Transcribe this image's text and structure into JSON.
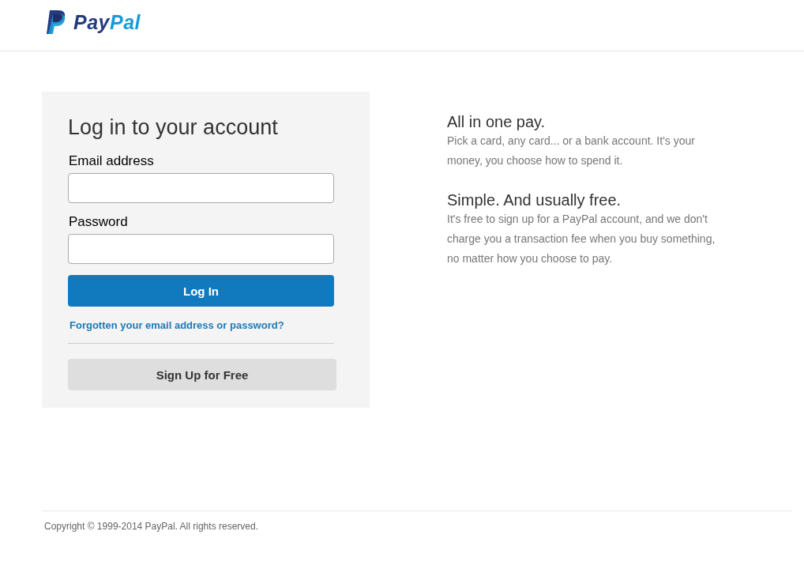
{
  "header": {
    "logo": {
      "parts": [
        "Pay",
        "Pal"
      ]
    }
  },
  "login": {
    "title": "Log in to your account",
    "fields": [
      {
        "label": "Email address"
      },
      {
        "label": "Password"
      }
    ],
    "login_button": "Log In",
    "forgot_link": "Forgotten your email address or password?",
    "signup_button": "Sign Up for Free"
  },
  "features": [
    {
      "heading": "All in one pay.",
      "text": "Pick a card, any card... or a bank account. It's your money, you choose how to spend it."
    },
    {
      "heading": "Simple. And usually free.",
      "text": "It's free to sign up for a PayPal account, and we don't charge you a transaction fee when you buy something, no matter how you choose to pay."
    }
  ],
  "footer": {
    "copyright": "Copyright © 1999-2014 PayPal. All rights reserved."
  }
}
